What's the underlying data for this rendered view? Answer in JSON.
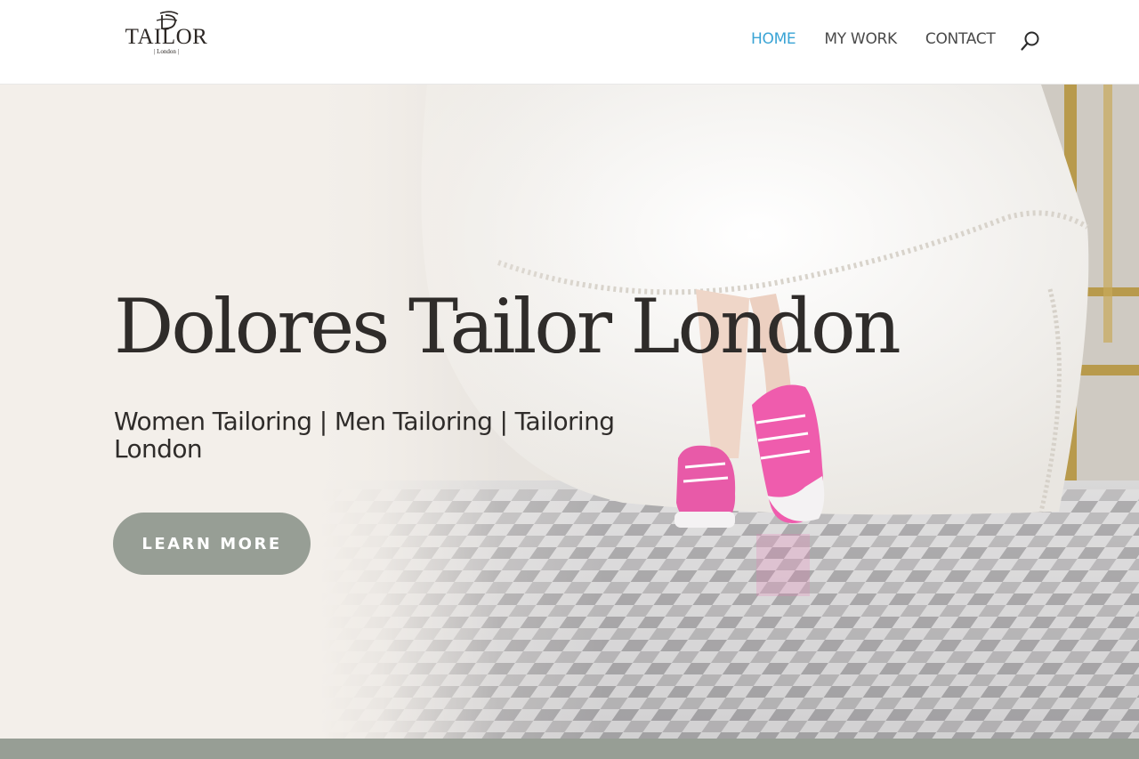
{
  "header": {
    "logo": {
      "word": "TAILOR",
      "sub": "| London |"
    },
    "nav": [
      {
        "label": "HOME",
        "active": true
      },
      {
        "label": "MY WORK",
        "active": false
      },
      {
        "label": "CONTACT",
        "active": false
      }
    ],
    "search_icon": "search-icon"
  },
  "hero": {
    "title": "Dolores Tailor London",
    "subtitle": "Women Tailoring | Men Tailoring | Tailoring London",
    "cta_label": "LEARN MORE"
  },
  "colors": {
    "accent": "#3aa4d5",
    "button": "#979e95",
    "text": "#2f2c2a",
    "hero_background": "#f3efea"
  }
}
